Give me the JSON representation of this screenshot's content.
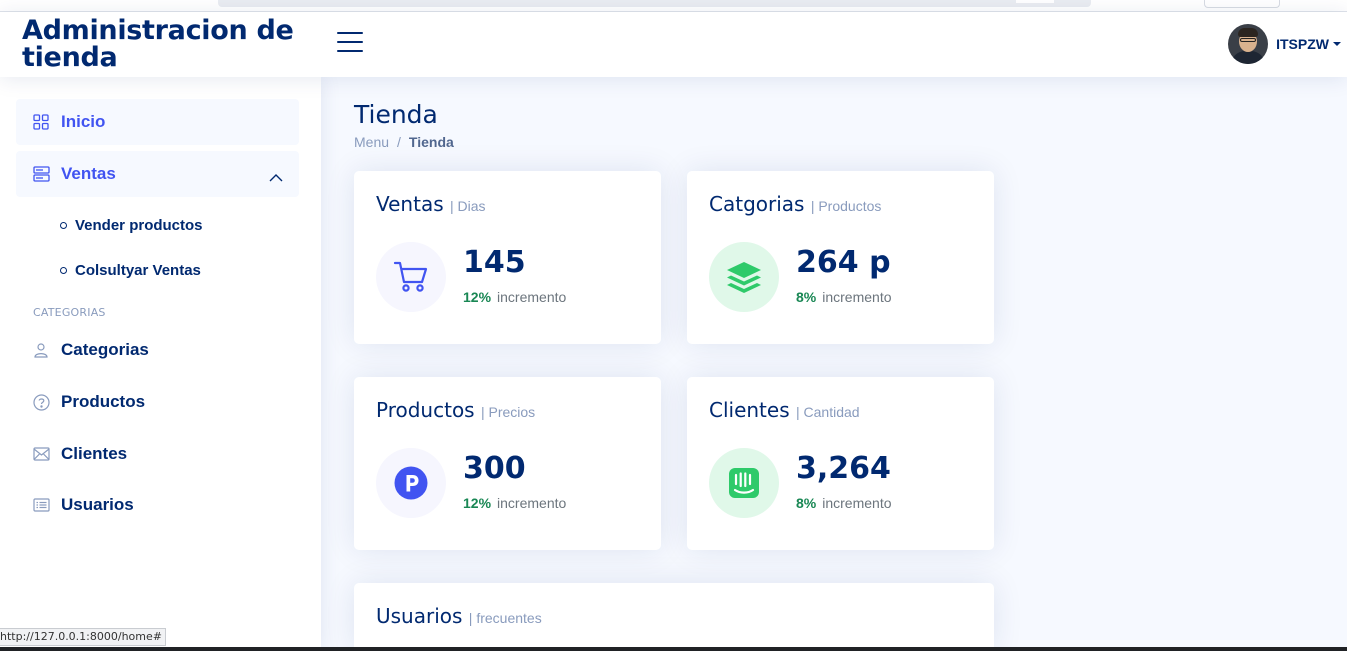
{
  "header": {
    "logo_text": "Administracion de tienda",
    "user_name": "ITSPZW"
  },
  "sidebar": {
    "items": [
      {
        "label": "Inicio",
        "icon": "grid-icon"
      },
      {
        "label": "Ventas",
        "icon": "menu-button-icon",
        "expanded": true
      },
      {
        "label": "Categorias",
        "icon": "person-icon"
      },
      {
        "label": "Productos",
        "icon": "question-circle-icon"
      },
      {
        "label": "Clientes",
        "icon": "envelope-icon"
      },
      {
        "label": "Usuarios",
        "icon": "card-list-icon"
      }
    ],
    "sub_items": [
      {
        "label": "Vender productos"
      },
      {
        "label": "Colsultyar Ventas"
      }
    ],
    "heading": "CATEGORIAS"
  },
  "page": {
    "title": "Tienda",
    "breadcrumb": [
      "Menu",
      "/",
      "Tienda"
    ]
  },
  "cards": [
    {
      "title": "Ventas",
      "subtitle": "| Dias",
      "value": "145",
      "pct": "12%",
      "pct_label": "incremento",
      "icon": "cart-icon",
      "icon_bg": "#f6f6fe",
      "icon_color": "#4154f1"
    },
    {
      "title": "Catgorias",
      "subtitle": "| Productos",
      "value": "264 p",
      "pct": "8%",
      "pct_label": "incremento",
      "icon": "stack-icon",
      "icon_bg": "#e0f8e9",
      "icon_color": "#2eca6a"
    },
    {
      "title": "Productos",
      "subtitle": "| Precios",
      "value": "300",
      "pct": "12%",
      "pct_label": "incremento",
      "icon": "p-circle-icon",
      "icon_bg": "#f6f6fe",
      "icon_color": "#4154f1"
    },
    {
      "title": "Clientes",
      "subtitle": "| Cantidad",
      "value": "3,264",
      "pct": "8%",
      "pct_label": "incremento",
      "icon": "intercom-icon",
      "icon_bg": "#e0f8e9",
      "icon_color": "#2eca6a"
    },
    {
      "title": "Usuarios",
      "subtitle": "| frecuentes"
    }
  ],
  "status_bar": {
    "url": "http://127.0.0.1:8000/home#"
  }
}
